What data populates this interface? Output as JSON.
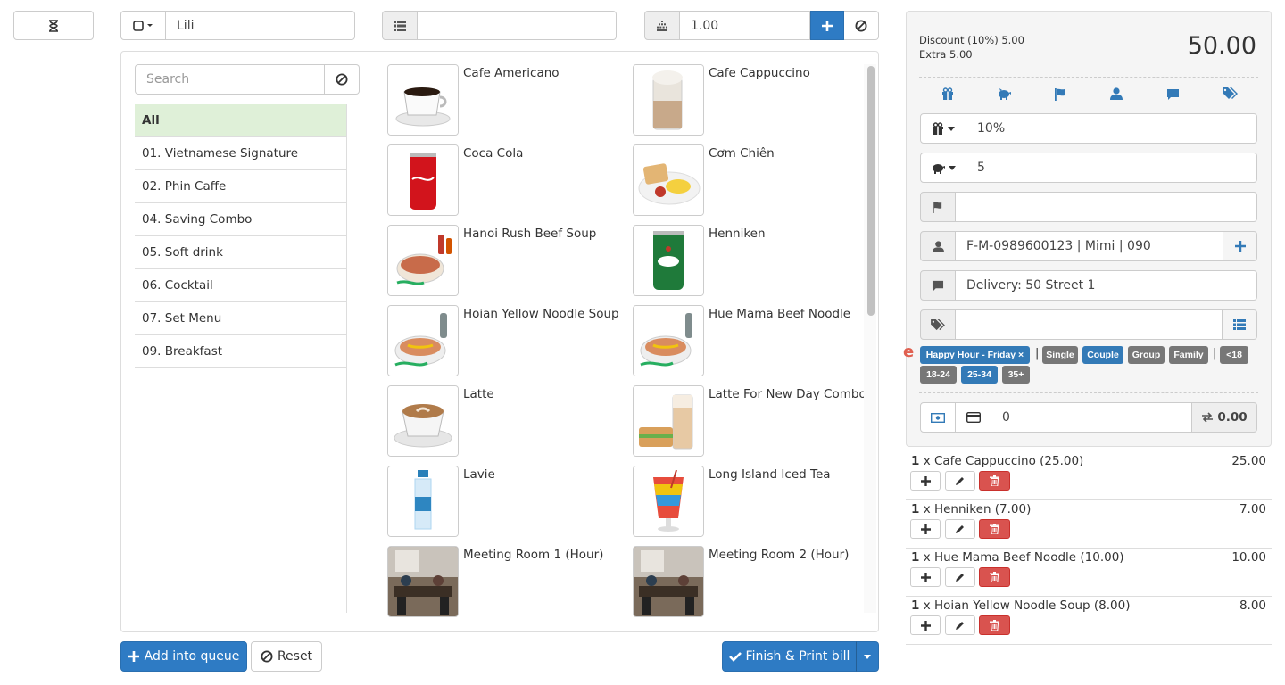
{
  "topbar": {
    "customer_name": "Lili",
    "table_value": "",
    "quantity_value": "1.00"
  },
  "categories": {
    "search_placeholder": "Search",
    "items": [
      "All",
      "01. Vietnamese Signature",
      "02. Phin Caffe",
      "04. Saving Combo",
      "05. Soft drink",
      "06. Cocktail",
      "07. Set Menu",
      "09. Breakfast"
    ]
  },
  "products": [
    {
      "name": "Cafe Americano",
      "icon": "coffee-cup"
    },
    {
      "name": "Cafe Cappuccino",
      "icon": "cappuccino-glass"
    },
    {
      "name": "Coca Cola",
      "icon": "cola-can"
    },
    {
      "name": "Cơm Chiên",
      "icon": "fried-rice-plate"
    },
    {
      "name": "Hanoi Rush Beef Soup",
      "icon": "soup-bowl"
    },
    {
      "name": "Henniken",
      "icon": "beer-can"
    },
    {
      "name": "Hoian Yellow Noodle Soup",
      "icon": "noodle-bowl"
    },
    {
      "name": "Hue Mama Beef Noodle",
      "icon": "noodle-bowl"
    },
    {
      "name": "Latte",
      "icon": "latte-cup"
    },
    {
      "name": "Latte For New Day Combo",
      "icon": "latte-combo"
    },
    {
      "name": "Lavie",
      "icon": "water-bottle"
    },
    {
      "name": "Long Island Iced Tea",
      "icon": "cocktail-glass"
    },
    {
      "name": "Meeting Room 1 (Hour)",
      "icon": "meeting-room"
    },
    {
      "name": "Meeting Room 2 (Hour)",
      "icon": "meeting-room"
    }
  ],
  "actions": {
    "add_queue": "Add into queue",
    "reset": "Reset",
    "finish": "Finish & Print bill"
  },
  "summary": {
    "discount_line": "Discount (10%) 5.00",
    "extra_line": "Extra 5.00",
    "total": "50.00"
  },
  "fields": {
    "discount": "10%",
    "extra": "5",
    "flag": "",
    "customer": "F-M-0989600123 | Mimi | 090",
    "note": "Delivery: 50 Street 1",
    "tags": ""
  },
  "tag_marker": "e",
  "tags": [
    "Happy Hour - Friday ×",
    "|",
    "Single",
    "Couple",
    "Group",
    "Family",
    "|",
    "<18",
    "18-24",
    "25-34",
    "35+"
  ],
  "payment": {
    "amount": "0",
    "change": "0.00"
  },
  "order": [
    {
      "qty": "1",
      "text": " x Cafe Cappuccino (25.00)",
      "amount": "25.00"
    },
    {
      "qty": "1",
      "text": " x Henniken (7.00)",
      "amount": "7.00"
    },
    {
      "qty": "1",
      "text": " x Hue Mama Beef Noodle (10.00)",
      "amount": "10.00"
    },
    {
      "qty": "1",
      "text": " x Hoian Yellow Noodle Soup (8.00)",
      "amount": "8.00"
    }
  ],
  "colors": {
    "primary": "#2e7bc4",
    "danger": "#d9534f",
    "active_category": "#dff0d8",
    "tag_gray": "#777777"
  }
}
